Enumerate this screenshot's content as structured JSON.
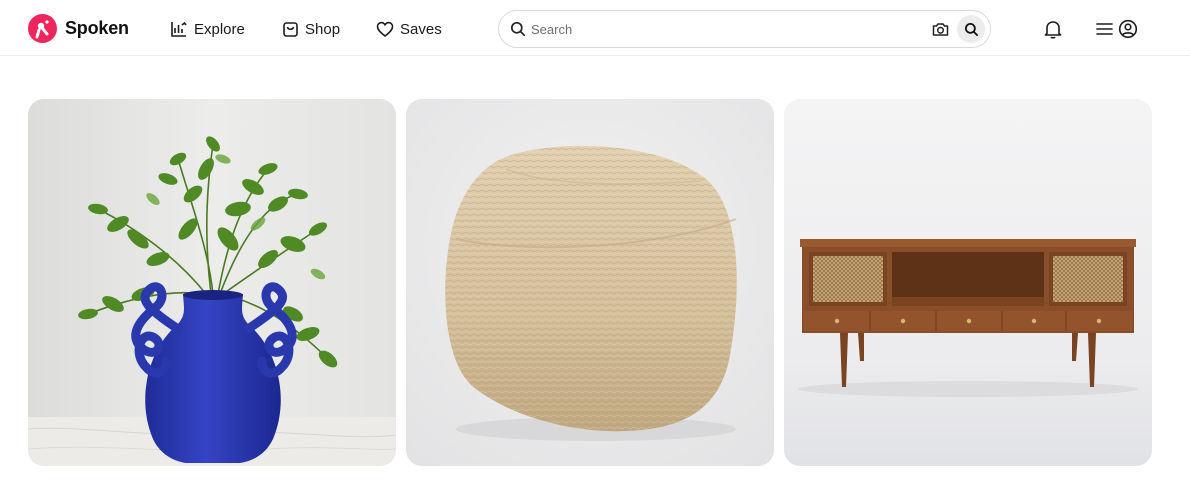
{
  "app": {
    "name": "Spoken"
  },
  "nav": {
    "explore_label": "Explore",
    "shop_label": "Shop",
    "saves_label": "Saves"
  },
  "search": {
    "placeholder": "Search",
    "value": ""
  },
  "icons": {
    "logo": "spoken-logo-icon",
    "explore": "chart-icon",
    "shop": "shopping-bag-icon",
    "saves": "heart-icon",
    "search": "search-icon",
    "camera": "camera-icon",
    "notifications": "bell-icon",
    "menu": "hamburger-icon",
    "account": "user-circle-icon"
  },
  "colors": {
    "brand": "#f0245e",
    "vase_blue": "#2f3fb8",
    "pouf": "#d8c4a3",
    "wood": "#8a4e2a"
  },
  "products": [
    {
      "image": "blue-vase-with-green-plant"
    },
    {
      "image": "woven-jute-pouf"
    },
    {
      "image": "wooden-media-console-with-cane-doors"
    }
  ]
}
